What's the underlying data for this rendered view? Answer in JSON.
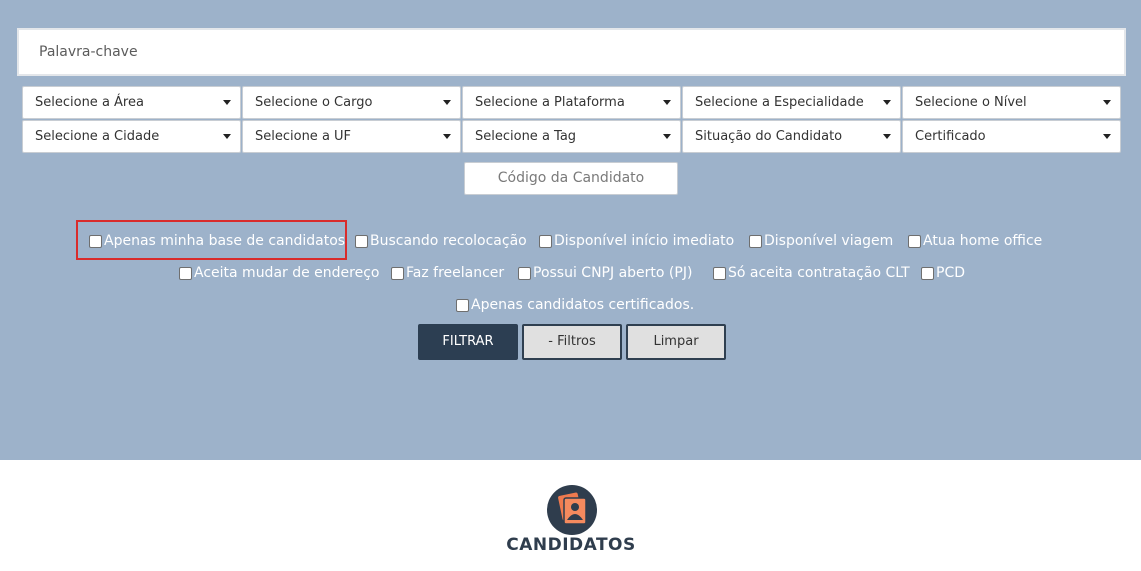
{
  "search": {
    "keyword_placeholder": "Palavra-chave",
    "code_placeholder": "Código da Candidato"
  },
  "selects_row1": [
    "Selecione a Área",
    "Selecione o Cargo",
    "Selecione a Plataforma",
    "Selecione a Especialidade",
    "Selecione o Nível"
  ],
  "selects_row2": [
    "Selecione a Cidade",
    "Selecione a UF",
    "Selecione a Tag",
    "Situação do Candidato",
    "Certificado"
  ],
  "checkboxes_row1": [
    "Apenas minha base de candidatos",
    "Buscando recolocação",
    "Disponível início imediato",
    "Disponível viagem",
    "Atua home office"
  ],
  "checkboxes_row2": [
    "Aceita mudar de endereço",
    "Faz freelancer",
    "Possui CNPJ aberto (PJ)",
    "Só aceita contratação CLT",
    "PCD"
  ],
  "checkboxes_row3": [
    "Apenas candidatos certificados."
  ],
  "buttons": {
    "filter": "FILTRAR",
    "less_filters": "- Filtros",
    "clear": "Limpar"
  },
  "brand": {
    "name": "CANDIDATOS",
    "icon": "candidate-card-icon"
  },
  "colors": {
    "panel": "#9db2ca",
    "dark": "#2c3e52",
    "accent": "#f07a4e",
    "highlight": "#d92b2b"
  }
}
